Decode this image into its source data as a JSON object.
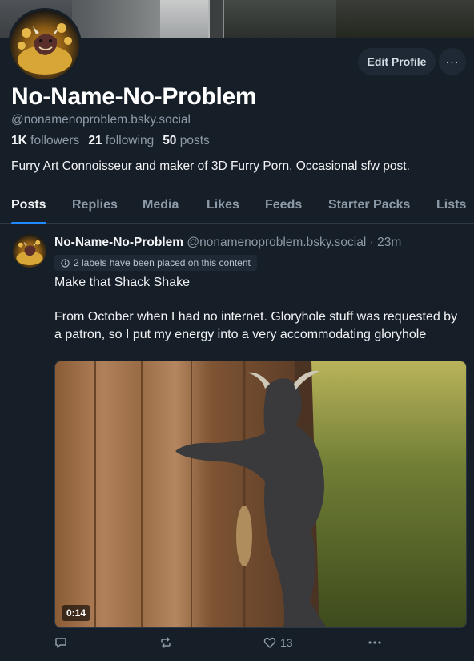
{
  "profile": {
    "display_name": "No-Name-No-Problem",
    "handle": "@nonamenoproblem.bsky.social",
    "followers_count": "1K",
    "followers_label": "followers",
    "following_count": "21",
    "following_label": "following",
    "posts_count": "50",
    "posts_label": "posts",
    "bio": "Furry Art Connoisseur and maker of 3D Furry Porn. Occasional sfw post.",
    "edit_label": "Edit Profile",
    "more_label": "···"
  },
  "tabs": [
    {
      "label": "Posts",
      "active": true
    },
    {
      "label": "Replies"
    },
    {
      "label": "Media"
    },
    {
      "label": "Likes"
    },
    {
      "label": "Feeds"
    },
    {
      "label": "Starter Packs"
    },
    {
      "label": "Lists"
    }
  ],
  "post": {
    "author": "No-Name-No-Problem",
    "handle": "@nonamenoproblem.bsky.social",
    "time": "· 23m",
    "label_text": "2 labels have been placed on this content",
    "text_line1": "Make that Shack Shake",
    "text_line2": "From October when I had no internet. Gloryhole stuff was requested by a patron, so I put my energy into a very accommodating gloryhole",
    "video_duration": "0:14",
    "like_count": "13"
  },
  "colors": {
    "background": "#161e27",
    "accent": "#208bfe",
    "muted_text": "#8d9aa8",
    "button_bg": "#1e2935"
  },
  "icons": [
    "reply-icon",
    "repost-icon",
    "like-icon",
    "more-icon",
    "info-icon"
  ]
}
